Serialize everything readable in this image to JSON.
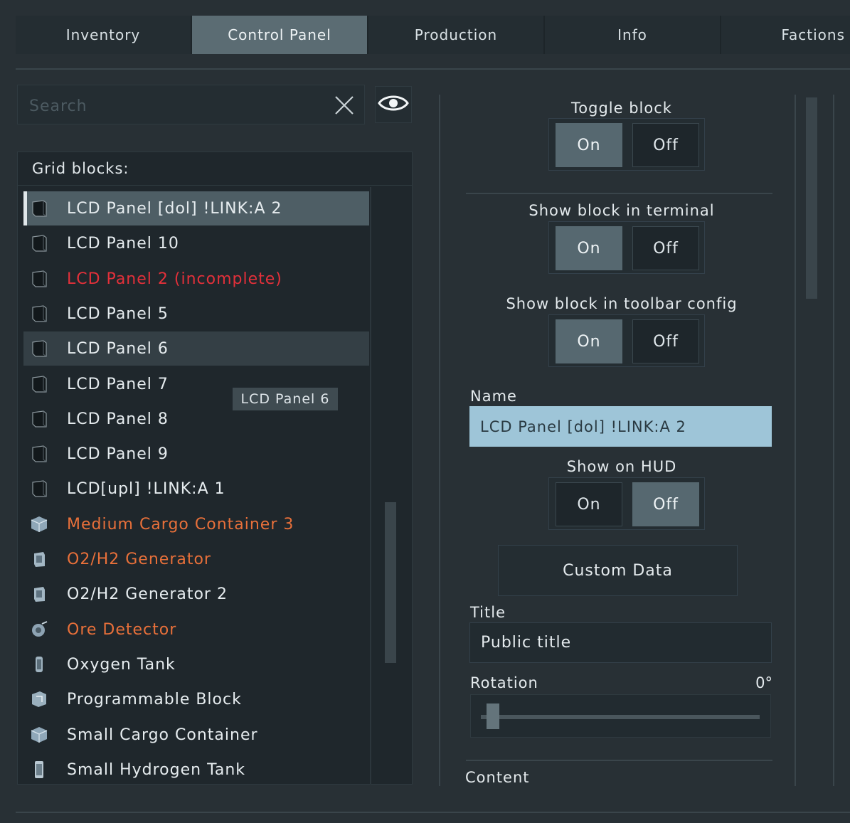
{
  "tabs": [
    {
      "label": "Inventory"
    },
    {
      "label": "Control Panel"
    },
    {
      "label": "Production"
    },
    {
      "label": "Info"
    },
    {
      "label": "Factions"
    }
  ],
  "search": {
    "placeholder": "Search",
    "value": ""
  },
  "grid_blocks": {
    "header": "Grid blocks:",
    "items": [
      {
        "label": "LCD Panel [dol] !LINK:A 2",
        "color": "#e6ecef",
        "icon": "lcd-panel-icon",
        "state": "selected"
      },
      {
        "label": "LCD Panel 10",
        "color": "#e6ecef",
        "icon": "lcd-panel-icon"
      },
      {
        "label": "LCD Panel 2 (incomplete)",
        "color": "#e3303a",
        "icon": "lcd-panel-icon"
      },
      {
        "label": "LCD Panel 5",
        "color": "#e6ecef",
        "icon": "lcd-panel-icon"
      },
      {
        "label": "LCD Panel 6",
        "color": "#e6ecef",
        "icon": "lcd-panel-icon",
        "state": "hover"
      },
      {
        "label": "LCD Panel 7",
        "color": "#e6ecef",
        "icon": "lcd-panel-icon"
      },
      {
        "label": "LCD Panel 8",
        "color": "#e6ecef",
        "icon": "lcd-panel-icon"
      },
      {
        "label": "LCD Panel 9",
        "color": "#e6ecef",
        "icon": "lcd-panel-icon"
      },
      {
        "label": "LCD[upl] !LINK:A 1",
        "color": "#e6ecef",
        "icon": "lcd-panel-icon"
      },
      {
        "label": "Medium Cargo Container 3",
        "color": "#e8703a",
        "icon": "cargo-container-icon"
      },
      {
        "label": "O2/H2 Generator",
        "color": "#e8703a",
        "icon": "o2h2-generator-icon"
      },
      {
        "label": "O2/H2 Generator 2",
        "color": "#e6ecef",
        "icon": "o2h2-generator-icon"
      },
      {
        "label": "Ore Detector",
        "color": "#e8703a",
        "icon": "ore-detector-icon"
      },
      {
        "label": "Oxygen Tank",
        "color": "#e6ecef",
        "icon": "oxygen-tank-icon"
      },
      {
        "label": "Programmable Block",
        "color": "#e6ecef",
        "icon": "programmable-block-icon"
      },
      {
        "label": "Small Cargo Container",
        "color": "#e6ecef",
        "icon": "cargo-container-icon"
      },
      {
        "label": "Small Hydrogen Tank",
        "color": "#e6ecef",
        "icon": "hydrogen-tank-icon"
      }
    ],
    "tooltip": "LCD Panel 6"
  },
  "panel": {
    "toggle_block": {
      "label": "Toggle block",
      "on": "On",
      "off": "Off",
      "value": "On"
    },
    "show_in_terminal": {
      "label": "Show block in terminal",
      "on": "On",
      "off": "Off",
      "value": "On"
    },
    "show_in_toolbar": {
      "label": "Show block in toolbar config",
      "on": "On",
      "off": "Off",
      "value": "On"
    },
    "name": {
      "label": "Name",
      "value": "LCD Panel [dol] !LINK:A 2"
    },
    "show_on_hud": {
      "label": "Show on HUD",
      "on": "On",
      "off": "Off",
      "value": "Off"
    },
    "custom_data": "Custom Data",
    "title": {
      "label": "Title",
      "value": "Public title"
    },
    "rotation": {
      "label": "Rotation",
      "value": "0°",
      "fraction": 0.0
    },
    "content_label": "Content"
  }
}
